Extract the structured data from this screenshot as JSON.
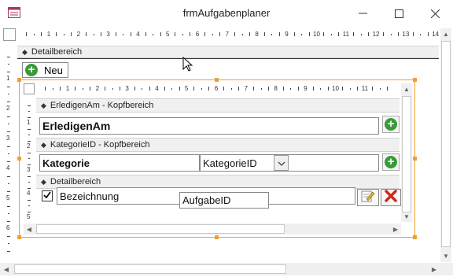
{
  "window": {
    "title": "frmAufgabenplaner",
    "icon": "form-icon",
    "buttons": {
      "minimize": "—",
      "maximize": "☐",
      "close": "✕"
    }
  },
  "ruler_top": [
    "1",
    "2",
    "3",
    "4",
    "5",
    "6",
    "7",
    "8",
    "9",
    "10",
    "11",
    "12",
    "13",
    "14"
  ],
  "ruler_left": [
    "1",
    "2",
    "3",
    "4",
    "5",
    "6"
  ],
  "ruler_inner_top": [
    "1",
    "2",
    "3",
    "4",
    "5",
    "6",
    "7",
    "8",
    "9",
    "10",
    "11"
  ],
  "ruler_inner_left": [
    "1",
    "2",
    "3",
    "4",
    "5"
  ],
  "outer": {
    "section_label": "Detailbereich",
    "new_button_label": "Neu"
  },
  "subform": {
    "header1_label": "ErledigenAm - Kopfbereich",
    "erledigenam_field": "ErledigenAm",
    "header2_label": "KategorieID - Kopfbereich",
    "kategorie_field": "Kategorie",
    "kategorieid_combo": "KategorieID",
    "detail_label": "Detailbereich",
    "bezeichnung_field": "Bezeichnung",
    "aufgabeid_field": "AufgabeID",
    "checkbox_checked": true
  },
  "colors": {
    "accent_orange": "#f0a030",
    "green": "#3a9a3a",
    "red": "#cc2a1a"
  }
}
